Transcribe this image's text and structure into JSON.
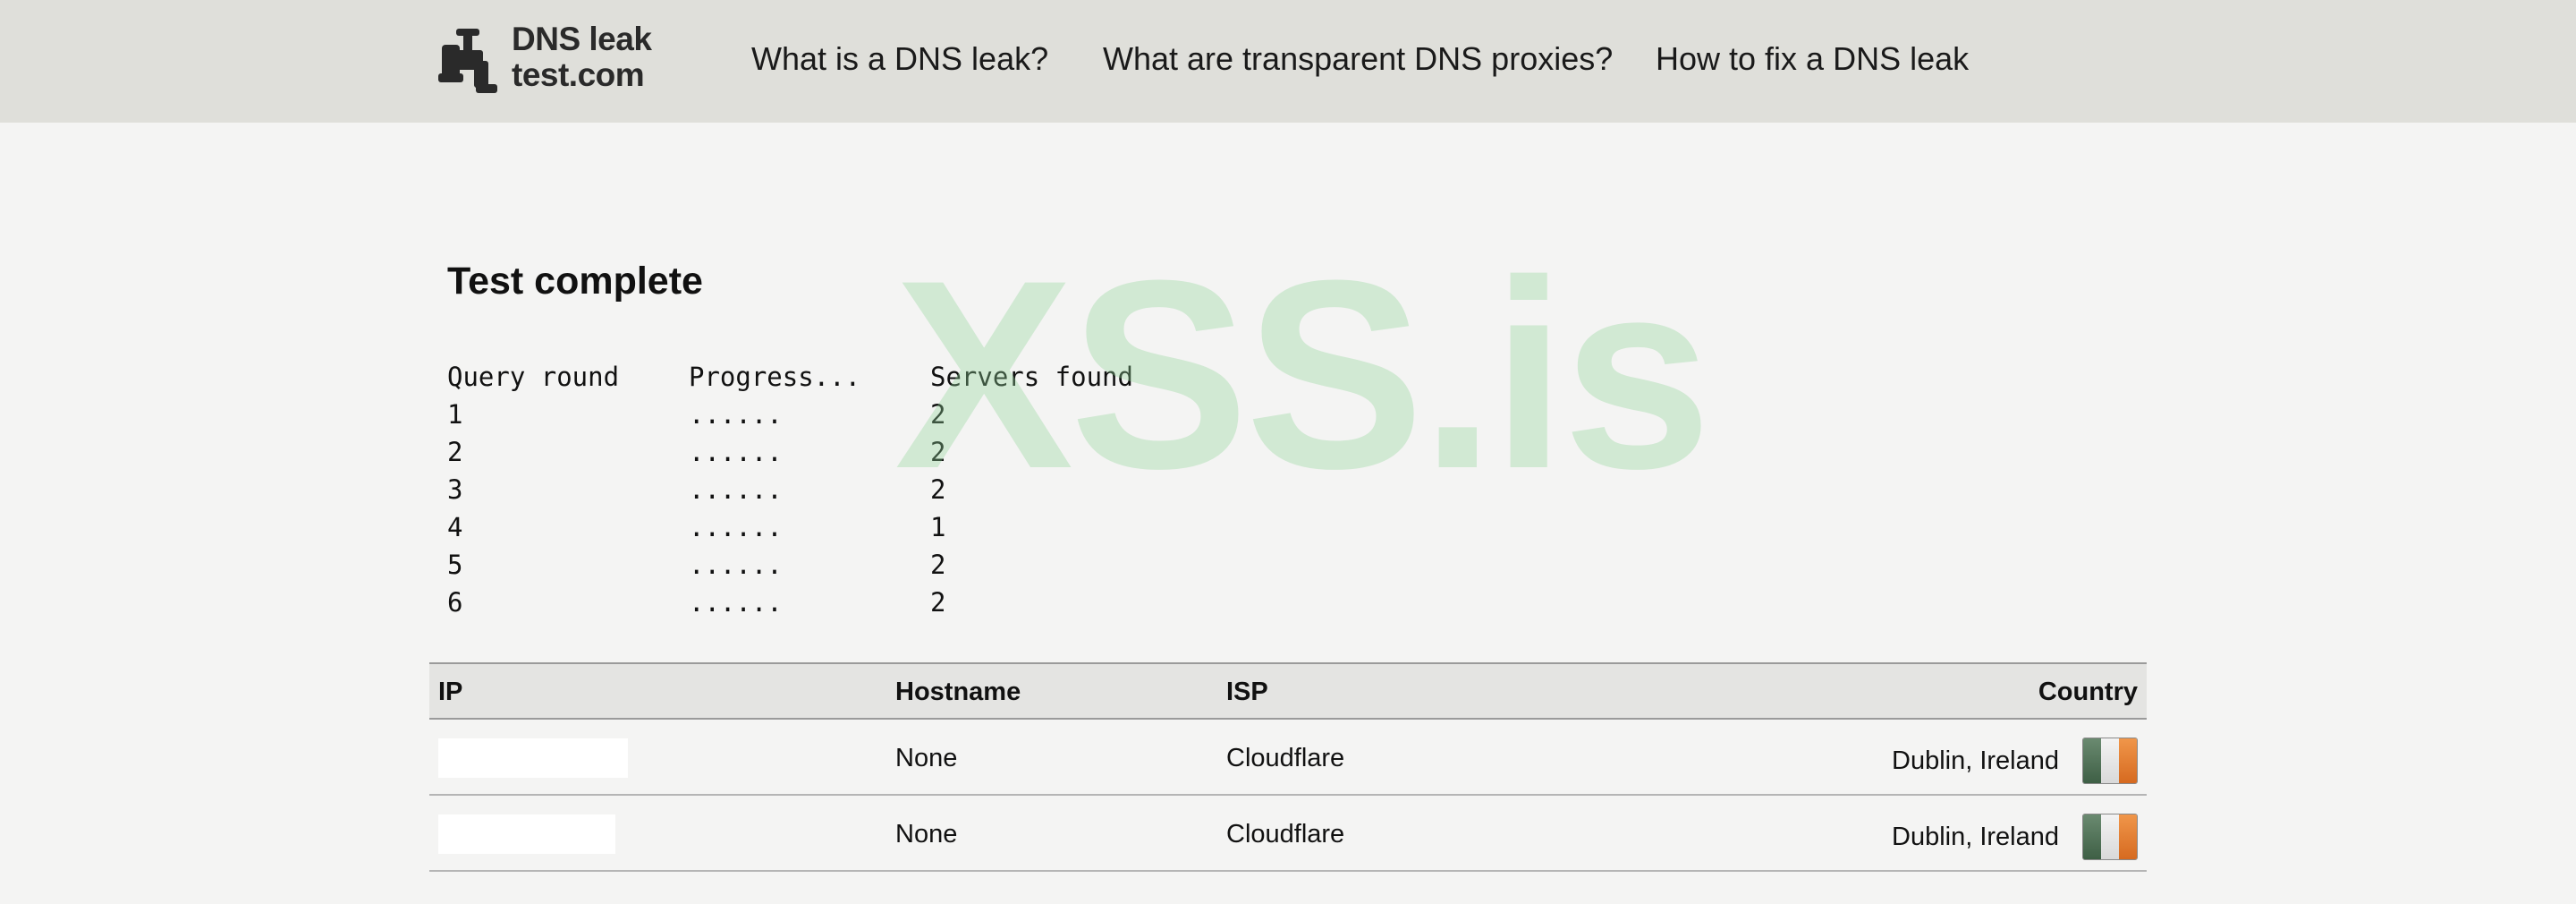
{
  "header": {
    "logo": {
      "line1": "DNS leak",
      "line2": "test.com"
    },
    "nav": [
      "What is a DNS leak?",
      "What are transparent DNS proxies?",
      "How to fix a DNS leak"
    ]
  },
  "watermark": "XSS.is",
  "title": "Test complete",
  "rounds": {
    "headers": [
      "Query round",
      "Progress...",
      "Servers found"
    ],
    "rows": [
      {
        "round": "1",
        "progress": "......",
        "servers": "2"
      },
      {
        "round": "2",
        "progress": "......",
        "servers": "2"
      },
      {
        "round": "3",
        "progress": "......",
        "servers": "2"
      },
      {
        "round": "4",
        "progress": "......",
        "servers": "1"
      },
      {
        "round": "5",
        "progress": "......",
        "servers": "2"
      },
      {
        "round": "6",
        "progress": "......",
        "servers": "2"
      }
    ]
  },
  "results": {
    "headers": {
      "ip": "IP",
      "hostname": "Hostname",
      "isp": "ISP",
      "country": "Country"
    },
    "rows": [
      {
        "ip": "",
        "hostname": "None",
        "isp": "Cloudflare",
        "country": "Dublin, Ireland",
        "flag": "ireland-flag-icon"
      },
      {
        "ip": "",
        "hostname": "None",
        "isp": "Cloudflare",
        "country": "Dublin, Ireland",
        "flag": "ireland-flag-icon"
      }
    ]
  },
  "colors": {
    "header_bg": "#dfdfda",
    "page_bg": "#f4f4f3",
    "table_header_bg": "#e4e4e2",
    "watermark": "#8fd397"
  }
}
